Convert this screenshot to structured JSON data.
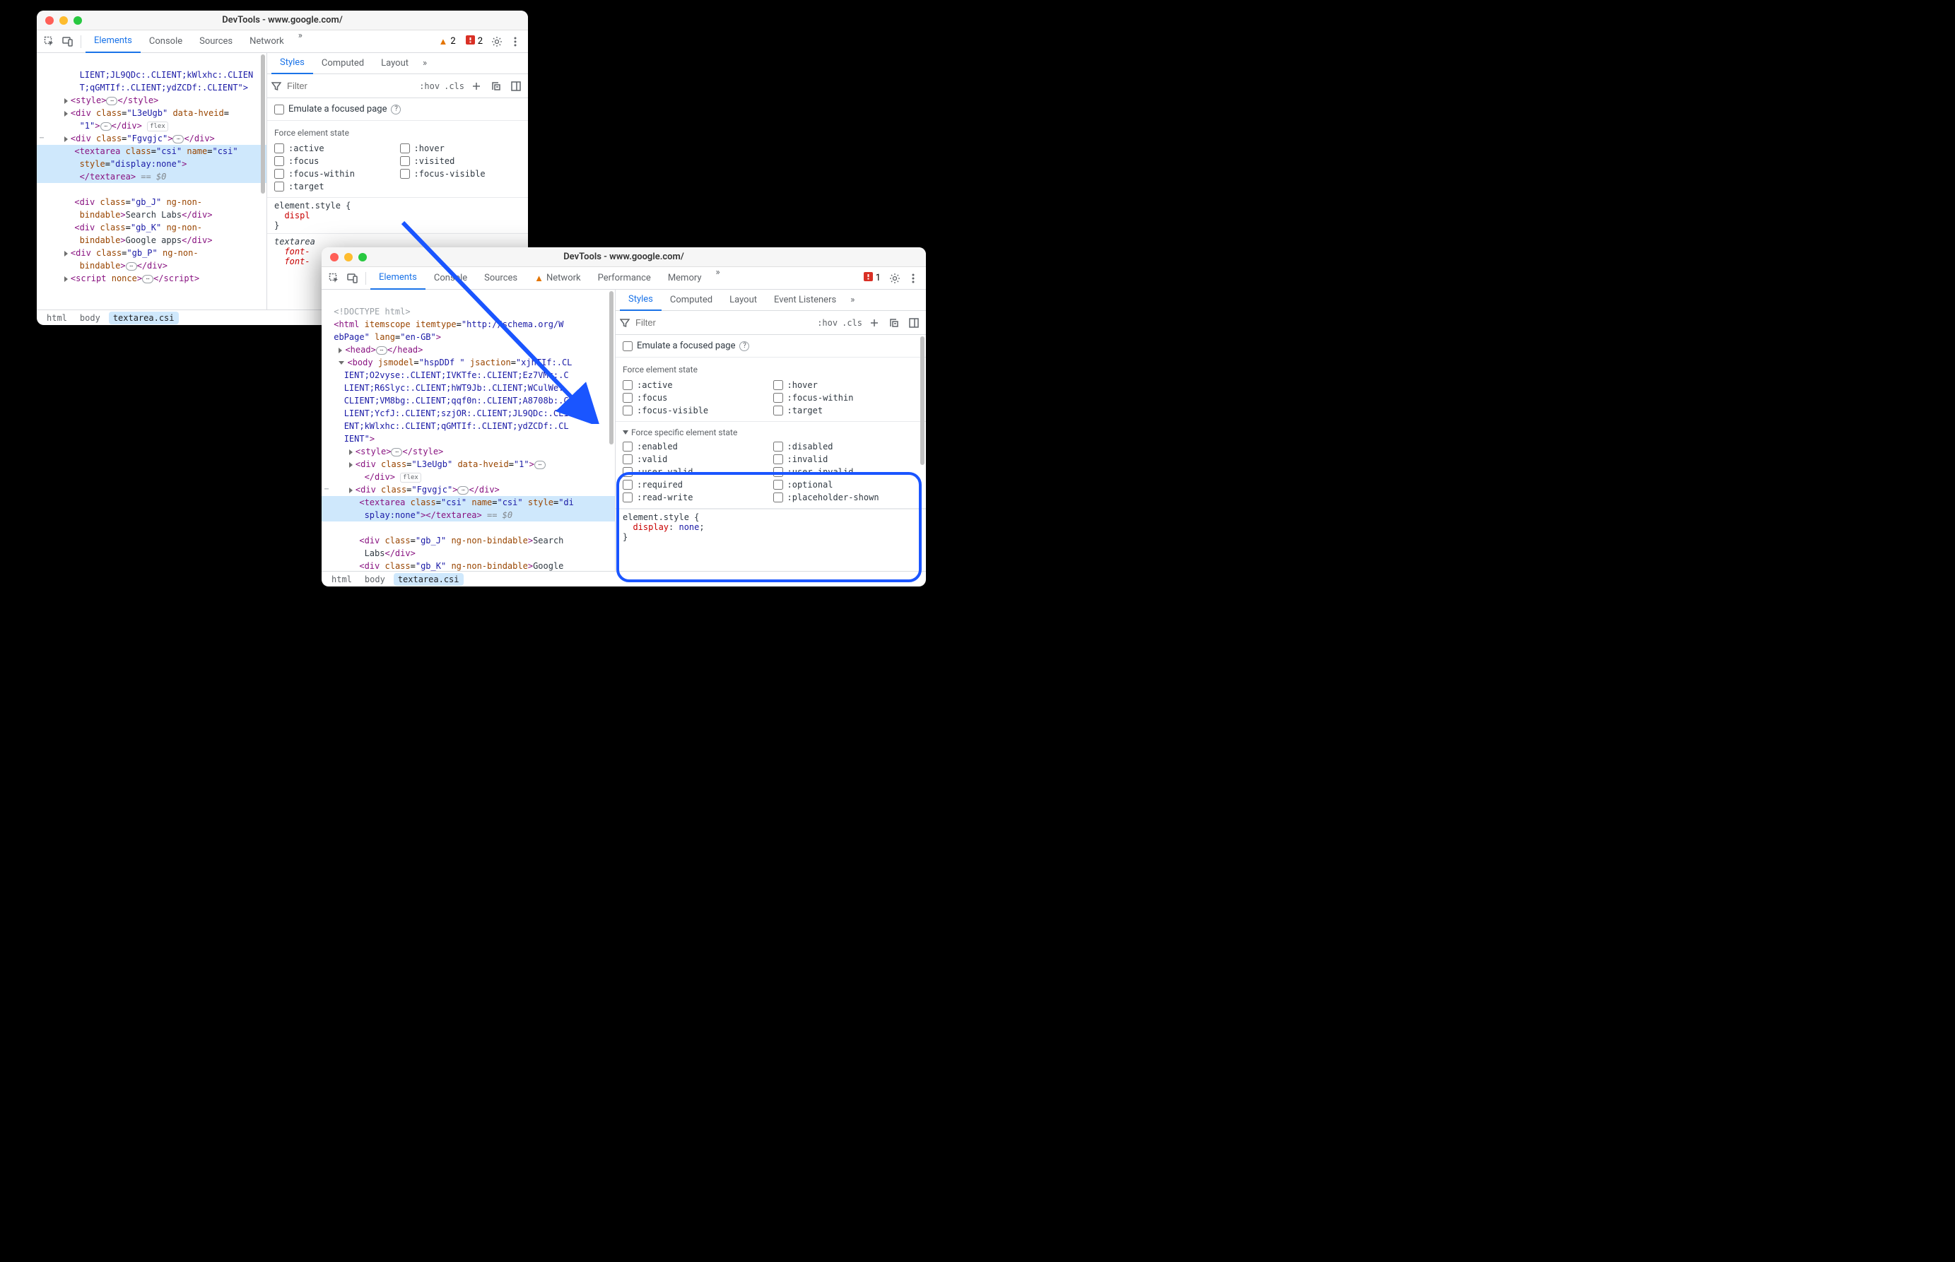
{
  "win1": {
    "title": "DevTools - www.google.com/",
    "tabs": [
      "Elements",
      "Console",
      "Sources",
      "Network"
    ],
    "more_tabs_glyph": "»",
    "warn_count": "2",
    "err_count": "2",
    "dom_prefix_line": "LIENT;JL9QDc:.CLIENT;kWlxhc:.CLIEN",
    "dom_prefix_line2": "T;qGMTIf:.CLIENT;ydZCDf:.CLIENT\">",
    "style_open": "<style>",
    "style_close": "</style>",
    "div_l3_open": "<div class=\"L3eUgb\" data-hveid=",
    "div_l3_open2": "\"1\">",
    "div_close": "</div>",
    "flex": "flex",
    "div_fg_open": "<div class=\"Fgvgjc\">",
    "ta_open": "<textarea class=\"csi\" name=\"csi\"",
    "ta_open2": "style=\"display:none\">",
    "ta_close": "</textarea>",
    "eq0": " == $0",
    "gbj_open": "<div class=\"gb_J\" ng-non-",
    "gbj_open2": "bindable>Search Labs</div>",
    "gbk_open": "<div class=\"gb_K\" ng-non-",
    "gbk_open2": "bindable>Google apps</div>",
    "gbp_open": "<div class=\"gb_P\" ng-non-",
    "gbp_open2": "bindable>",
    "script_open": "<script nonce>",
    "script_close": "</script>",
    "crumbs": [
      "html",
      "body",
      "textarea.csi"
    ],
    "stabs": [
      "Styles",
      "Computed",
      "Layout"
    ],
    "filter_ph": "Filter",
    "hov": ":hov",
    "cls": ".cls",
    "emulate_label": "Emulate a focused page",
    "force_label": "Force element state",
    "state_left": [
      ":active",
      ":focus",
      ":focus-within",
      ":target"
    ],
    "state_right": [
      ":hover",
      ":visited",
      ":focus-visible"
    ],
    "es_open": "element.style {",
    "es_prop": "displ",
    "es_close": "}",
    "ta_sel": "textarea",
    "font_prop": "font-",
    "font_prop2": "font-"
  },
  "win2": {
    "title": "DevTools - www.google.com/",
    "tabs": [
      "Elements",
      "Console",
      "Sources"
    ],
    "net_label": "Network",
    "tabs_right": [
      "Performance",
      "Memory"
    ],
    "more_tabs_glyph": "»",
    "err_count": "1",
    "doctype": "<!DOCTYPE html>",
    "html_open1": "<html itemscope itemtype=\"http://schema.org/W",
    "html_open2": "ebPage\" lang=\"en-GB\">",
    "head_open": "<head>",
    "head_close": "</head>",
    "body_open": "<body jsmodel=\"hspDDf \" jsaction=\"xjhTIf:.CL",
    "body_l2": "IENT;O2vyse:.CLIENT;IVKTfe:.CLIENT;Ez7VMc:.C",
    "body_l3": "LIENT;R6Slyc:.CLIENT;hWT9Jb:.CLIENT;WCulWe:.",
    "body_l4": "CLIENT;VM8bg:.CLIENT;qqf0n:.CLIENT;A8708b:.C",
    "body_l5": "LIENT;YcfJ:.CLIENT;szjOR:.CLIENT;JL9QDc:.CLI",
    "body_l6": "ENT;kWlxhc:.CLIENT;qGMTIf:.CLIENT;ydZCDf:.CL",
    "body_l7": "IENT\">",
    "style_open": "<style>",
    "style_close": "</style>",
    "div_l3": "<div class=\"L3eUgb\" data-hveid=\"1\">",
    "div_close": "</div>",
    "flex": "flex",
    "div_fg_open": "<div class=\"Fgvgjc\">",
    "ta_line": "<textarea class=\"csi\" name=\"csi\" style=\"di",
    "ta_line2": "splay:none\"></textarea>",
    "eq0": " == $0",
    "gbj": "<div class=\"gb_J\" ng-non-bindable>Search",
    "gbj2": "Labs</div>",
    "gbk": "<div class=\"gb_K\" ng-non-bindable>Google",
    "crumbs": [
      "html",
      "body",
      "textarea.csi"
    ],
    "stabs": [
      "Styles",
      "Computed",
      "Layout",
      "Event Listeners"
    ],
    "filter_ph": "Filter",
    "hov": ":hov",
    "cls": ".cls",
    "emulate_label": "Emulate a focused page",
    "force_label": "Force element state",
    "state_left": [
      ":active",
      ":focus",
      ":focus-visible"
    ],
    "state_right": [
      ":hover",
      ":focus-within",
      ":target"
    ],
    "force_specific_label": "Force specific element state",
    "spec_left": [
      ":enabled",
      ":valid",
      ":user-valid",
      ":required",
      ":read-write"
    ],
    "spec_right": [
      ":disabled",
      ":invalid",
      ":user-invalid",
      ":optional",
      ":placeholder-shown"
    ],
    "es_open": "element.style {",
    "es_prop": "display",
    "es_val": "none",
    "es_close": "}"
  }
}
